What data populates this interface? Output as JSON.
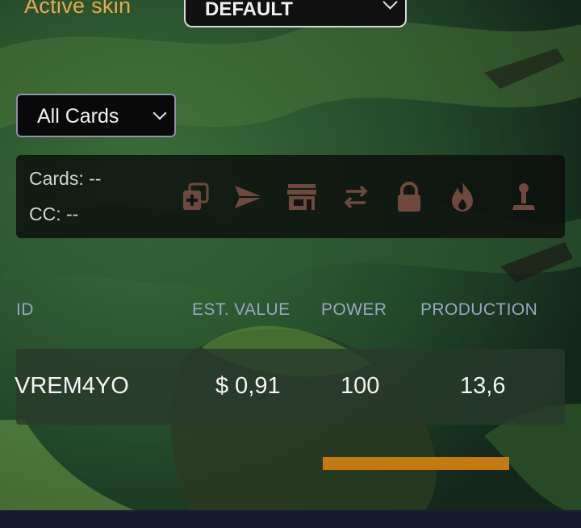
{
  "header": {
    "active_skin_label": "Active skin",
    "skin_select_value": "DEFAULT"
  },
  "filter": {
    "selected": "All Cards"
  },
  "stats": {
    "cards_label": "Cards: --",
    "cc_label": "CC: --"
  },
  "actions": [
    {
      "name": "combine-icon"
    },
    {
      "name": "send-icon"
    },
    {
      "name": "market-store-icon"
    },
    {
      "name": "transfer-arrows-icon"
    },
    {
      "name": "lock-icon"
    },
    {
      "name": "burn-fire-icon"
    },
    {
      "name": "joystick-icon"
    }
  ],
  "table": {
    "columns": [
      "ID",
      "EST. VALUE",
      "POWER",
      "PRODUCTION"
    ],
    "rows": [
      {
        "id": "VREM4YO",
        "est_value": "$ 0,91",
        "power": "100",
        "production": "13,6"
      }
    ]
  },
  "progress": {
    "fraction": 1.0
  },
  "colors": {
    "accent_orange": "#e8a850",
    "progress": "#c47a12",
    "icon": "#6e4a3e",
    "footer": "#191b30"
  }
}
